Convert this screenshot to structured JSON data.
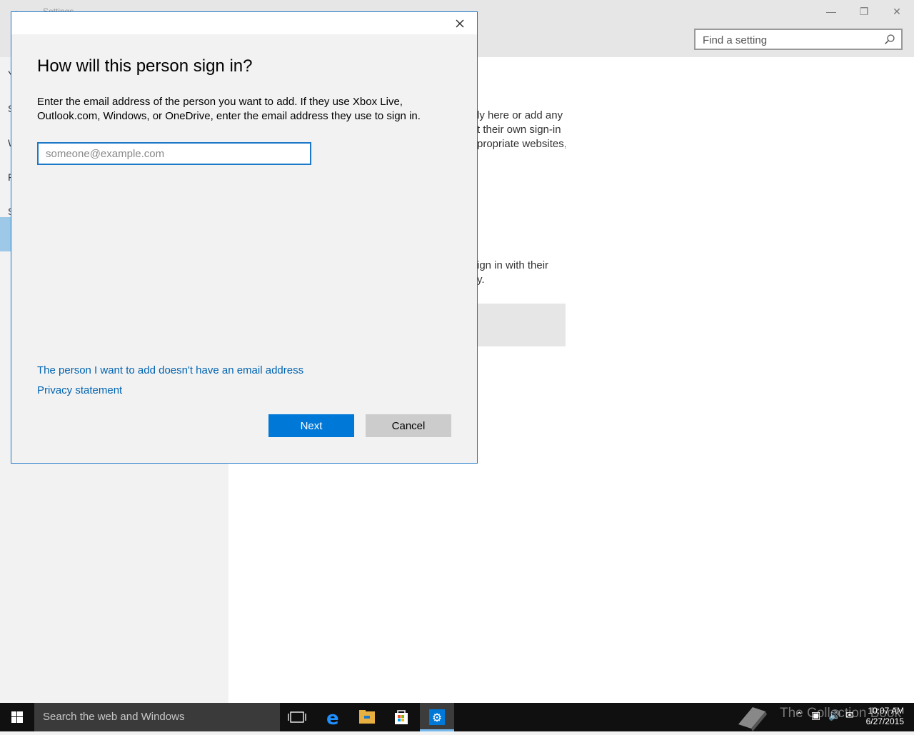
{
  "window": {
    "title": "Settings",
    "search_placeholder": "Find a setting"
  },
  "left_pane": {
    "items": [
      "Y",
      "S",
      "W",
      "F",
      "S"
    ]
  },
  "content": {
    "lines": [
      "ly here or add any",
      "t their own sign-in",
      "propriate websites,",
      "ign in with their",
      "y."
    ]
  },
  "dialog": {
    "title": "How will this person sign in?",
    "description": "Enter the email address of the person you want to add. If they use Xbox Live, Outlook.com, Windows, or OneDrive, enter the email address they use to sign in.",
    "email_placeholder": "someone@example.com",
    "email_value": "",
    "no_email_link": "The person I want to add doesn't have an email address",
    "privacy_link": "Privacy statement",
    "next_label": "Next",
    "cancel_label": "Cancel"
  },
  "taskbar": {
    "search_placeholder": "Search the web and Windows",
    "watermark": "The Collection Book",
    "time": "10:07 AM",
    "date": "6/27/2015",
    "accent_color": "#0078d7"
  }
}
